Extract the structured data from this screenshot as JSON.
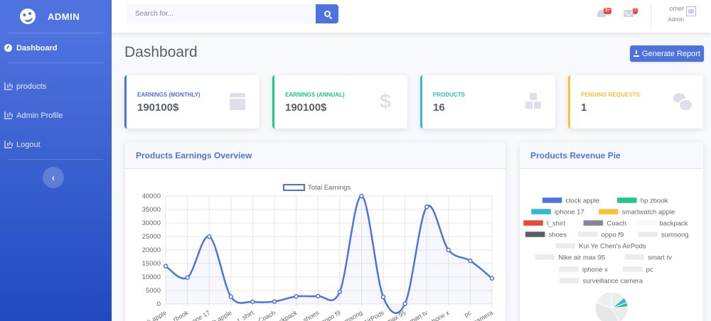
{
  "sidebar": {
    "brand": "ADMIN",
    "items": [
      {
        "label": "Dashboard",
        "active": true,
        "icon": "tachometer-icon"
      },
      {
        "label": "products",
        "icon": "chart-area-icon"
      },
      {
        "label": "Admin Profile",
        "icon": "chart-area-icon"
      },
      {
        "label": "Logout",
        "icon": "chart-area-icon"
      }
    ],
    "toggle_glyph": "‹"
  },
  "topbar": {
    "search_placeholder": "Search for...",
    "alerts_badge": "3+",
    "messages_badge": "7",
    "user_name": "omer",
    "user_role": "Admin"
  },
  "page": {
    "title": "Dashboard",
    "report_button": "Generate Report"
  },
  "cards": [
    {
      "label": "EARNINGS (MONTHLY)",
      "value": "190100$",
      "color": "#4e73df",
      "icon": "calendar-icon"
    },
    {
      "label": "EARNINGS (ANNUAL)",
      "value": "190100$",
      "color": "#1cc88a",
      "icon": "dollar-icon"
    },
    {
      "label": "PRODUCTS",
      "value": "16",
      "color": "#36b9cc",
      "icon": "boxes-icon"
    },
    {
      "label": "PENDING REQUESTS",
      "value": "1",
      "color": "#f6c23e",
      "icon": "comments-icon"
    }
  ],
  "line_panel": {
    "title": "Products Earnings Overview"
  },
  "pie_panel": {
    "title": "Products Revenue Pie"
  },
  "chart_data": [
    {
      "type": "line",
      "categories": [
        "clock apple",
        "hp zbook",
        "iphone 17",
        "smartwatch apple",
        "t_shirt",
        "Coach",
        "backpack",
        "shoes",
        "oppo f9",
        "sumsong",
        "Kui Ye Chen's AirPods",
        "Nike air max 95",
        "smart tv",
        "iphone x",
        "pc",
        "surveillance camera"
      ],
      "x_tick_labels": [
        "ck apple",
        "p zbook",
        "phone 17",
        "ch apple",
        "t_shirt",
        "Coach",
        "ackpack",
        "shoes",
        "oppo f9",
        "umsong",
        "AirPods",
        "max 95",
        "mart tv",
        "phone x",
        "pc",
        "camera"
      ],
      "series": [
        {
          "name": "Total Earnings",
          "values": [
            14000,
            9800,
            25000,
            2700,
            800,
            900,
            2800,
            2900,
            4500,
            40000,
            2600,
            50,
            36000,
            20000,
            16000,
            9500
          ],
          "color": "#4e73df"
        }
      ],
      "ylim": [
        0,
        40000
      ],
      "yticks": [
        0,
        5000,
        10000,
        15000,
        20000,
        25000,
        30000,
        35000,
        40000
      ],
      "legend": "top",
      "grid": true
    },
    {
      "type": "pie",
      "legend": "top",
      "entries": [
        {
          "label": "clock apple",
          "color": "#4e73df"
        },
        {
          "label": "hp zbook",
          "color": "#1cc88a"
        },
        {
          "label": "iphone 17",
          "color": "#36b9cc"
        },
        {
          "label": "smartwatch apple",
          "color": "#f6c23e"
        },
        {
          "label": "t_shirt",
          "color": "#e74a3b"
        },
        {
          "label": "Coach",
          "color": "#858796"
        },
        {
          "label": "backpack",
          "color": "#f8f9fc"
        },
        {
          "label": "shoes",
          "color": "#5a5c69"
        },
        {
          "label": "oppo f9",
          "color": "#ececec"
        },
        {
          "label": "sumsong",
          "color": "#ececec"
        },
        {
          "label": "Kui Ye Chen's AirPods",
          "color": "#ececec"
        },
        {
          "label": "Nike air max 95",
          "color": "#ececec"
        },
        {
          "label": "smart tv",
          "color": "#ececec"
        },
        {
          "label": "iphone x",
          "color": "#ececec"
        },
        {
          "label": "pc",
          "color": "#ececec"
        },
        {
          "label": "surveillance camera",
          "color": "#ececec"
        }
      ]
    }
  ]
}
